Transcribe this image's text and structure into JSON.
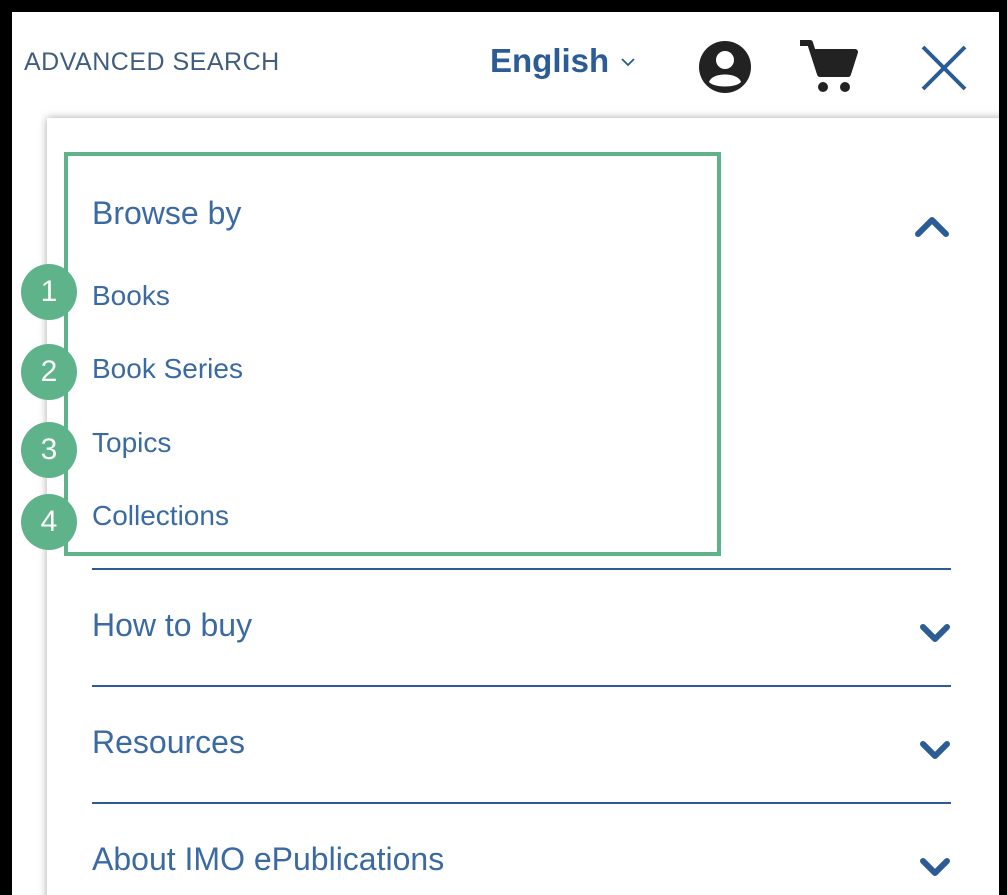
{
  "header": {
    "advanced_search": "ADVANCED SEARCH",
    "language": "English"
  },
  "icons": {
    "account": "account-circle-icon",
    "cart": "shopping-cart-icon",
    "close": "close-icon",
    "language_dropdown": "chevron-down-icon"
  },
  "menu": {
    "browse": {
      "title": "Browse by",
      "expanded": true,
      "items": [
        {
          "badge": "1",
          "label": "Books"
        },
        {
          "badge": "2",
          "label": "Book Series"
        },
        {
          "badge": "3",
          "label": "Topics"
        },
        {
          "badge": "4",
          "label": "Collections"
        }
      ]
    },
    "sections": [
      {
        "label": "How to buy"
      },
      {
        "label": "Resources"
      },
      {
        "label": "About IMO ePublications"
      }
    ]
  },
  "colors": {
    "link": "#3b6aa3",
    "accent": "#2b5c96",
    "highlight": "#5fb38a"
  }
}
